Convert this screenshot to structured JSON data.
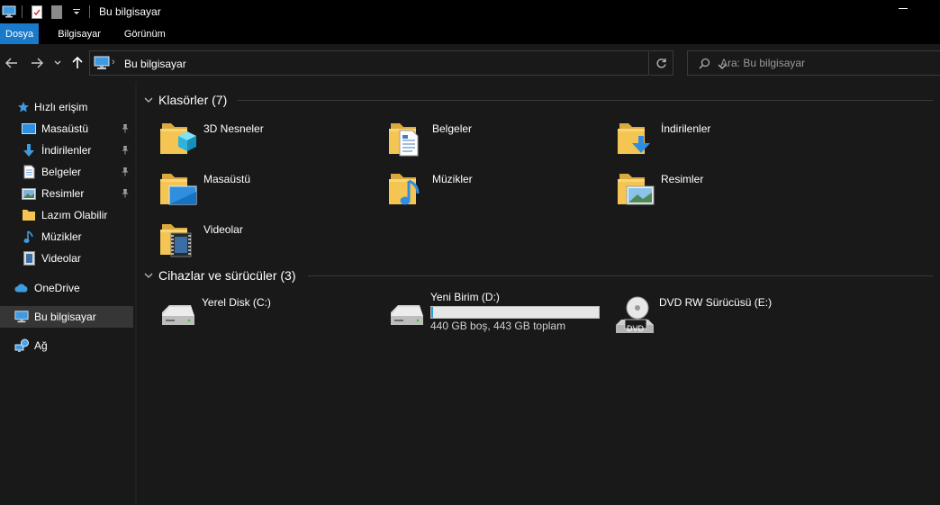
{
  "window": {
    "title": "Bu bilgisayar"
  },
  "ribbon": {
    "tabs": [
      "Dosya",
      "Bilgisayar",
      "Görünüm"
    ]
  },
  "address": {
    "path": "Bu bilgisayar"
  },
  "search": {
    "placeholder": "Ara: Bu bilgisayar"
  },
  "sidebar": {
    "quick_access": "Hızlı erişim",
    "items": [
      {
        "label": "Masaüstü",
        "icon": "desktop-icon",
        "pinned": true
      },
      {
        "label": "İndirilenler",
        "icon": "download-icon",
        "pinned": true
      },
      {
        "label": "Belgeler",
        "icon": "documents-icon",
        "pinned": true
      },
      {
        "label": "Resimler",
        "icon": "pictures-icon",
        "pinned": true
      },
      {
        "label": "Lazım Olabilir",
        "icon": "folder-icon",
        "pinned": false
      },
      {
        "label": "Müzikler",
        "icon": "music-icon",
        "pinned": false
      },
      {
        "label": "Videolar",
        "icon": "videos-icon",
        "pinned": false
      }
    ],
    "onedrive": "OneDrive",
    "this_pc": "Bu bilgisayar",
    "network": "Ağ"
  },
  "folders_group": {
    "header": "Klasörler (7)",
    "items": [
      {
        "label": "3D Nesneler",
        "icon": "3d-objects-folder-icon"
      },
      {
        "label": "Belgeler",
        "icon": "documents-folder-icon"
      },
      {
        "label": "İndirilenler",
        "icon": "downloads-folder-icon"
      },
      {
        "label": "Masaüstü",
        "icon": "desktop-folder-icon"
      },
      {
        "label": "Müzikler",
        "icon": "music-folder-icon"
      },
      {
        "label": "Resimler",
        "icon": "pictures-folder-icon"
      },
      {
        "label": "Videolar",
        "icon": "videos-folder-icon"
      }
    ]
  },
  "drives_group": {
    "header": "Cihazlar ve sürücüler (3)",
    "items": [
      {
        "label": "Yerel Disk (C:)",
        "icon": "hard-disk-icon"
      },
      {
        "label": "Yeni Birim (D:)",
        "icon": "hard-disk-icon",
        "free_space": "440 GB boş, 443 GB toplam",
        "used_fraction": 0.007
      },
      {
        "label": "DVD RW Sürücüsü (E:)",
        "icon": "dvd-drive-icon",
        "disc_text": "DVD"
      }
    ]
  },
  "colors": {
    "accent": "#1979ca",
    "folder": "#f4c553",
    "usage_bar": "#26a0da"
  }
}
